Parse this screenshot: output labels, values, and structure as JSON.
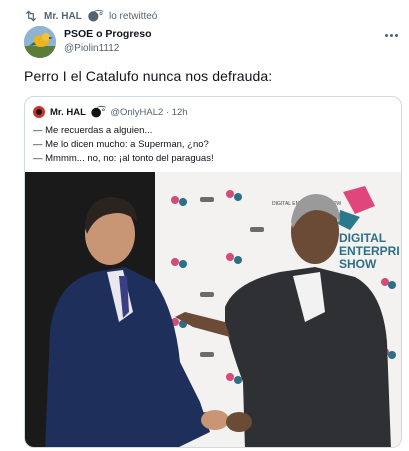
{
  "retweet": {
    "text": "Mr. HAL⬤͡° lo retwitteó",
    "name": "Mr. HAL",
    "suffix": "lo retwitteó"
  },
  "author": {
    "name": "PSOE o Progreso",
    "handle": "@Piolin1112"
  },
  "tweet": {
    "text": "Perro I el Catalufo nunca nos defrauda:"
  },
  "quote": {
    "name": "Mr. HAL",
    "handle_time": "@OnlyHAL2 · 12h",
    "lines": [
      "— Me recuerdas a alguien...",
      "— Me lo dicen mucho: a Superman, ¿no?",
      "— Mmmm... no, no: ¡al tonto del paraguas!"
    ]
  },
  "photo": {
    "banner_text_line1": "DIGITAL",
    "banner_text_line2": "ENTERPRI",
    "banner_text_line3": "SHOW",
    "logo_small": "DIGITAL ENTERPRISE SHOW"
  },
  "colors": {
    "text": "#0f1419",
    "secondary": "#536471",
    "border": "#cfd9de",
    "accent_pink": "#e0457b",
    "accent_teal": "#2a7a8c"
  }
}
